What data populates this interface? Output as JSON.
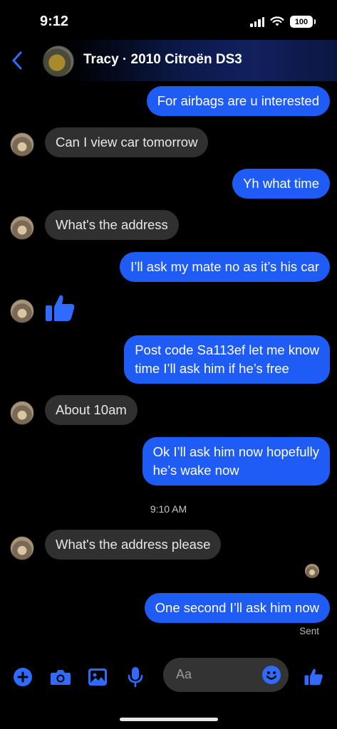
{
  "status": {
    "time": "9:12",
    "battery": "100"
  },
  "header": {
    "title": "Tracy · 2010 Citroën DS3"
  },
  "messages": [
    {
      "text": "For airbags are u interested"
    },
    {
      "text": "Can I view car tomorrow"
    },
    {
      "text": "Yh what time"
    },
    {
      "text": "What's the address"
    },
    {
      "text": "I’ll ask my mate  no as it’s his car"
    },
    {
      "line1": "Post code Sa113ef let me know",
      "line2": "time I’ll ask him if he’s free"
    },
    {
      "text": "About 10am"
    },
    {
      "line1": "Ok I’ll ask him now hopefully",
      "line2": "he’s wake now"
    },
    {
      "text": "What's the address please"
    },
    {
      "text": "One second I’ll ask him now"
    }
  ],
  "timestamp": "9:10 AM",
  "sent_label": "Sent",
  "composer": {
    "placeholder": "Aa"
  },
  "colors": {
    "outgoing": "#1e5cf5",
    "incoming": "#303030",
    "accent": "#2f6bff"
  }
}
